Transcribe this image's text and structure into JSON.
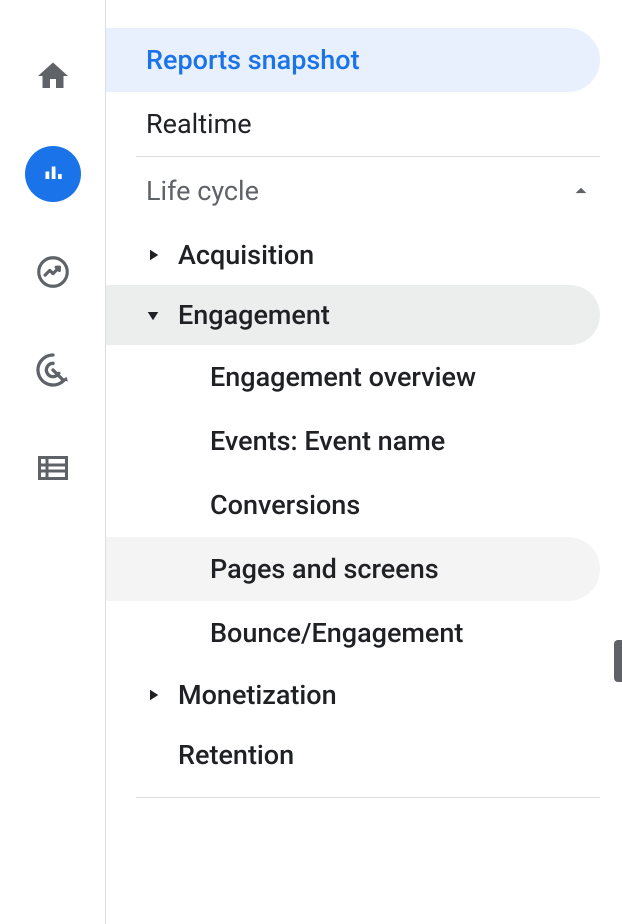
{
  "rail": {
    "home": "home-icon",
    "reports": "bar-chart-icon",
    "explore": "trend-circle-icon",
    "advertising": "target-click-icon",
    "configure": "list-icon"
  },
  "nav": {
    "reports_snapshot": "Reports snapshot",
    "realtime": "Realtime",
    "life_cycle": {
      "label": "Life cycle",
      "acquisition": "Acquisition",
      "engagement": {
        "label": "Engagement",
        "overview": "Engagement overview",
        "events": "Events: Event name",
        "conversions": "Conversions",
        "pages": "Pages and screens",
        "bounce": "Bounce/Engagement"
      },
      "monetization": "Monetization",
      "retention": "Retention"
    }
  }
}
